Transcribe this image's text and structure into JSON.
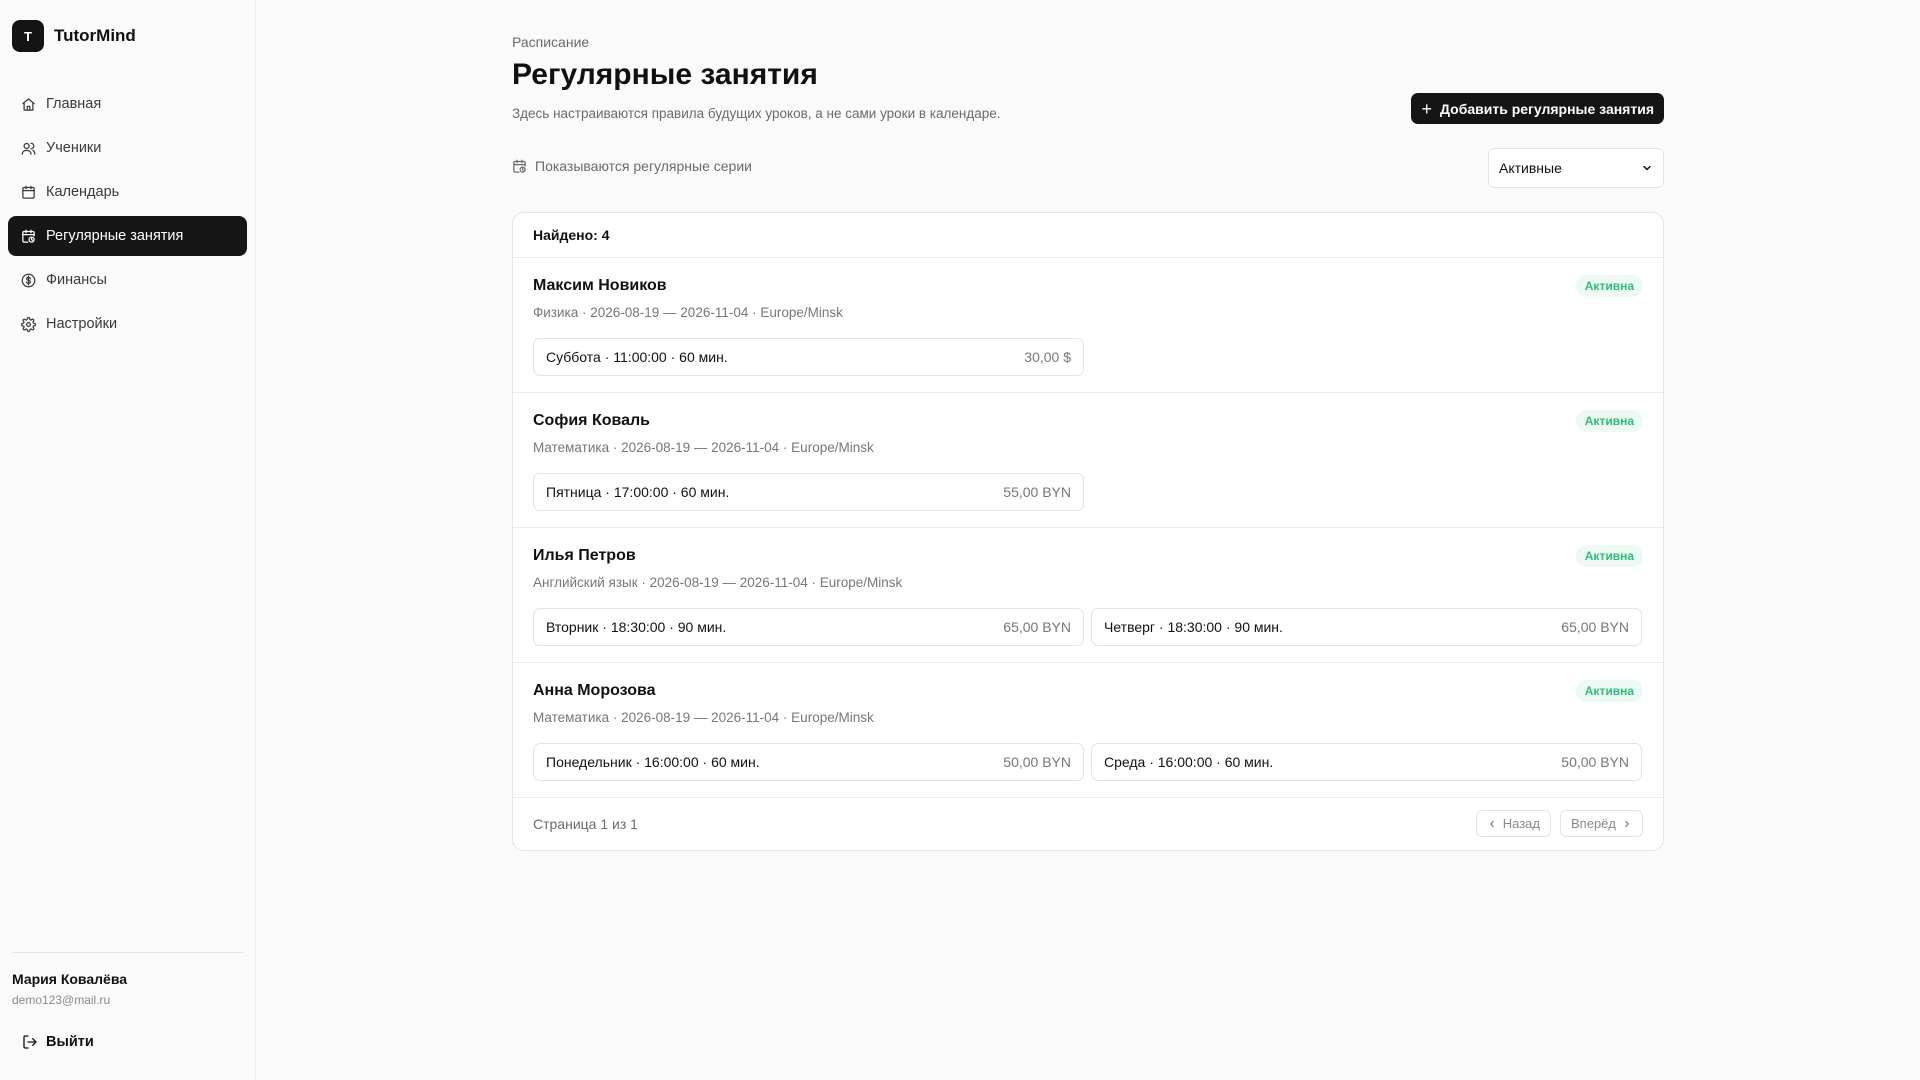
{
  "brand": {
    "logo_letter": "T",
    "name": "TutorMind"
  },
  "sidebar": {
    "items": [
      {
        "label": "Главная",
        "icon": "home-icon",
        "active": false
      },
      {
        "label": "Ученики",
        "icon": "users-icon",
        "active": false
      },
      {
        "label": "Календарь",
        "icon": "calendar-icon",
        "active": false
      },
      {
        "label": "Регулярные занятия",
        "icon": "calendar-repeat-icon",
        "active": true
      },
      {
        "label": "Финансы",
        "icon": "dollar-circle-icon",
        "active": false
      },
      {
        "label": "Настройки",
        "icon": "gear-icon",
        "active": false
      }
    ],
    "user": {
      "name": "Мария Ковалёва",
      "email": "demo123@mail.ru"
    },
    "logout_label": "Выйти"
  },
  "header": {
    "breadcrumb": "Расписание",
    "title": "Регулярные занятия",
    "subtitle": "Здесь настраиваются правила будущих уроков, а не сами уроки в календаре.",
    "add_button_label": "Добавить регулярные занятия"
  },
  "filter": {
    "note": "Показываются регулярные серии",
    "status_selected": "Активные"
  },
  "list": {
    "found_label": "Найдено: 4",
    "series": [
      {
        "student": "Максим Новиков",
        "meta": "Физика · 2026-08-19 — 2026-11-04 · Europe/Minsk",
        "status": "Активна",
        "slots": [
          {
            "label": "Суббота · 11:00:00 · 60 мин.",
            "price": "30,00 $"
          }
        ]
      },
      {
        "student": "София Коваль",
        "meta": "Математика · 2026-08-19 — 2026-11-04 · Europe/Minsk",
        "status": "Активна",
        "slots": [
          {
            "label": "Пятница · 17:00:00 · 60 мин.",
            "price": "55,00 BYN"
          }
        ]
      },
      {
        "student": "Илья Петров",
        "meta": "Английский язык · 2026-08-19 — 2026-11-04 · Europe/Minsk",
        "status": "Активна",
        "slots": [
          {
            "label": "Вторник · 18:30:00 · 90 мин.",
            "price": "65,00 BYN"
          },
          {
            "label": "Четверг · 18:30:00 · 90 мин.",
            "price": "65,00 BYN"
          }
        ]
      },
      {
        "student": "Анна Морозова",
        "meta": "Математика · 2026-08-19 — 2026-11-04 · Europe/Minsk",
        "status": "Активна",
        "slots": [
          {
            "label": "Понедельник · 16:00:00 · 60 мин.",
            "price": "50,00 BYN"
          },
          {
            "label": "Среда · 16:00:00 · 60 мин.",
            "price": "50,00 BYN"
          }
        ]
      }
    ],
    "pagination": {
      "info": "Страница 1 из 1",
      "prev_label": "Назад",
      "next_label": "Вперёд"
    }
  },
  "colors": {
    "accent": "#151515",
    "status_active": "#2fbf7a",
    "status_active_bg": "#edf9f3"
  }
}
